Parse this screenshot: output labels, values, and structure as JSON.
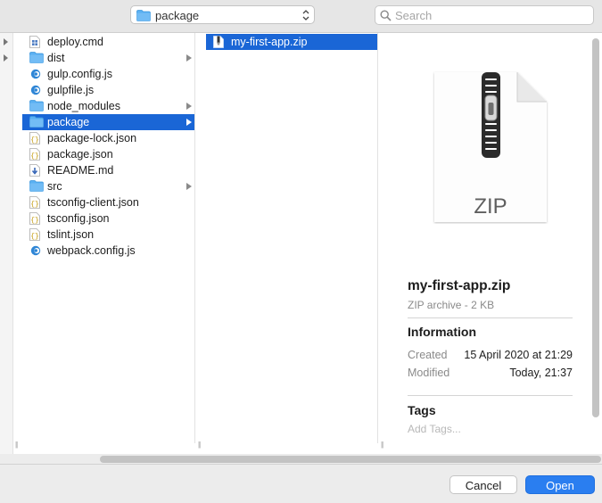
{
  "toolbar": {
    "path_label": "package",
    "search_placeholder": "Search"
  },
  "columns": {
    "col1_items": [
      {
        "label": "deploy.cmd",
        "icon": "script-file-icon",
        "folder": false
      },
      {
        "label": "dist",
        "icon": "folder-icon",
        "folder": true
      },
      {
        "label": "gulp.config.js",
        "icon": "js-file-icon",
        "folder": false
      },
      {
        "label": "gulpfile.js",
        "icon": "js-file-icon",
        "folder": false
      },
      {
        "label": "node_modules",
        "icon": "folder-icon",
        "folder": true
      },
      {
        "label": "package",
        "icon": "folder-icon",
        "folder": true,
        "selected": true
      },
      {
        "label": "package-lock.json",
        "icon": "json-file-icon",
        "folder": false
      },
      {
        "label": "package.json",
        "icon": "json-file-icon",
        "folder": false
      },
      {
        "label": "README.md",
        "icon": "markdown-file-icon",
        "folder": false
      },
      {
        "label": "src",
        "icon": "folder-icon",
        "folder": true
      },
      {
        "label": "tsconfig-client.json",
        "icon": "json-file-icon",
        "folder": false
      },
      {
        "label": "tsconfig.json",
        "icon": "json-file-icon",
        "folder": false
      },
      {
        "label": "tslint.json",
        "icon": "json-file-icon",
        "folder": false
      },
      {
        "label": "webpack.config.js",
        "icon": "js-file-icon",
        "folder": false
      }
    ],
    "col2_items": [
      {
        "label": "my-first-app.zip",
        "icon": "zip-file-icon",
        "selected": true
      }
    ]
  },
  "preview": {
    "icon_text": "ZIP",
    "file_name": "my-first-app.zip",
    "kind": "ZIP archive - 2 KB",
    "info_heading": "Information",
    "created_label": "Created",
    "created_value": "15 April 2020 at 21:29",
    "modified_label": "Modified",
    "modified_value": "Today, 21:37",
    "tags_heading": "Tags",
    "tags_placeholder": "Add Tags..."
  },
  "buttons": {
    "cancel": "Cancel",
    "open": "Open"
  },
  "colors": {
    "selection": "#1a66d6",
    "folder": "#5ab0f2",
    "primary_button": "#2a7ef0"
  }
}
